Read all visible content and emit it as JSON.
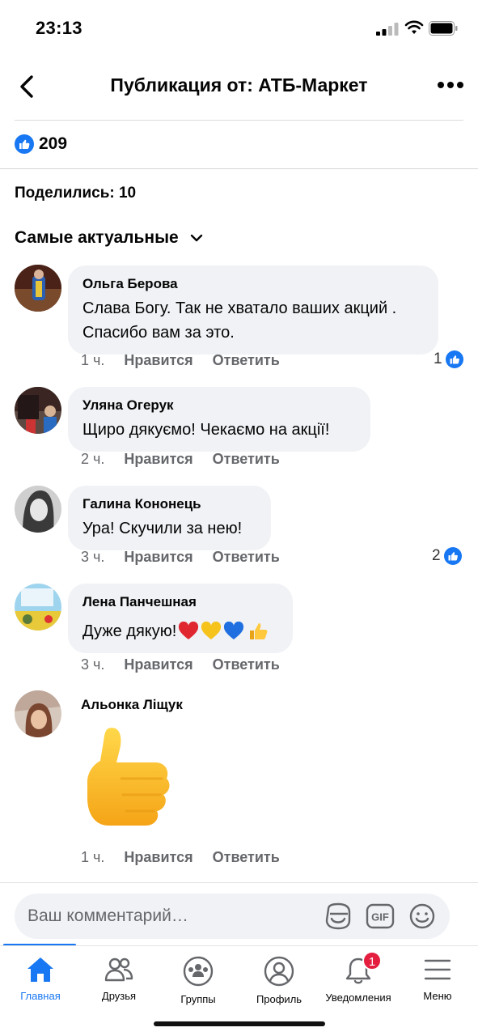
{
  "status_bar": {
    "time": "23:13"
  },
  "header": {
    "title": "Публикация от: АТБ-Маркет"
  },
  "post": {
    "like_count": "209",
    "shares": "Поделились: 10"
  },
  "sort": {
    "label": "Самые актуальные"
  },
  "comments": [
    {
      "author": "Ольга Берова",
      "text_line1": "Слава Богу. Так не хватало ваших акций .",
      "text_line2": "Спасибо вам за это.",
      "time": "1 ч.",
      "like_action": "Нравится",
      "reply_action": "Ответить",
      "reactions": "1"
    },
    {
      "author": "Уляна Огерук",
      "text": "Щиро дякуємо! Чекаємо на акції!",
      "time": "2 ч.",
      "like_action": "Нравится",
      "reply_action": "Ответить"
    },
    {
      "author": "Галина Кононець",
      "text": "Ура! Скучили за нею!",
      "time": "3 ч.",
      "like_action": "Нравится",
      "reply_action": "Ответить",
      "reactions": "2"
    },
    {
      "author": "Лена Панчешная",
      "text": "Дуже дякую!",
      "time": "3 ч.",
      "like_action": "Нравится",
      "reply_action": "Ответить"
    },
    {
      "author": "Альонка Ліщук",
      "sticker": "thumbs-up",
      "time": "1 ч.",
      "like_action": "Нравится",
      "reply_action": "Ответить"
    }
  ],
  "composer": {
    "placeholder": "Ваш комментарий…"
  },
  "tabs": [
    {
      "label": "Главная",
      "active": true
    },
    {
      "label": "Друзья"
    },
    {
      "label": "Группы"
    },
    {
      "label": "Профиль"
    },
    {
      "label": "Уведомления",
      "badge": "1"
    },
    {
      "label": "Меню"
    }
  ],
  "colors": {
    "accent": "#1877f2",
    "bubble": "#f0f2f5",
    "meta": "#65676b",
    "badge": "#e41e3f"
  }
}
